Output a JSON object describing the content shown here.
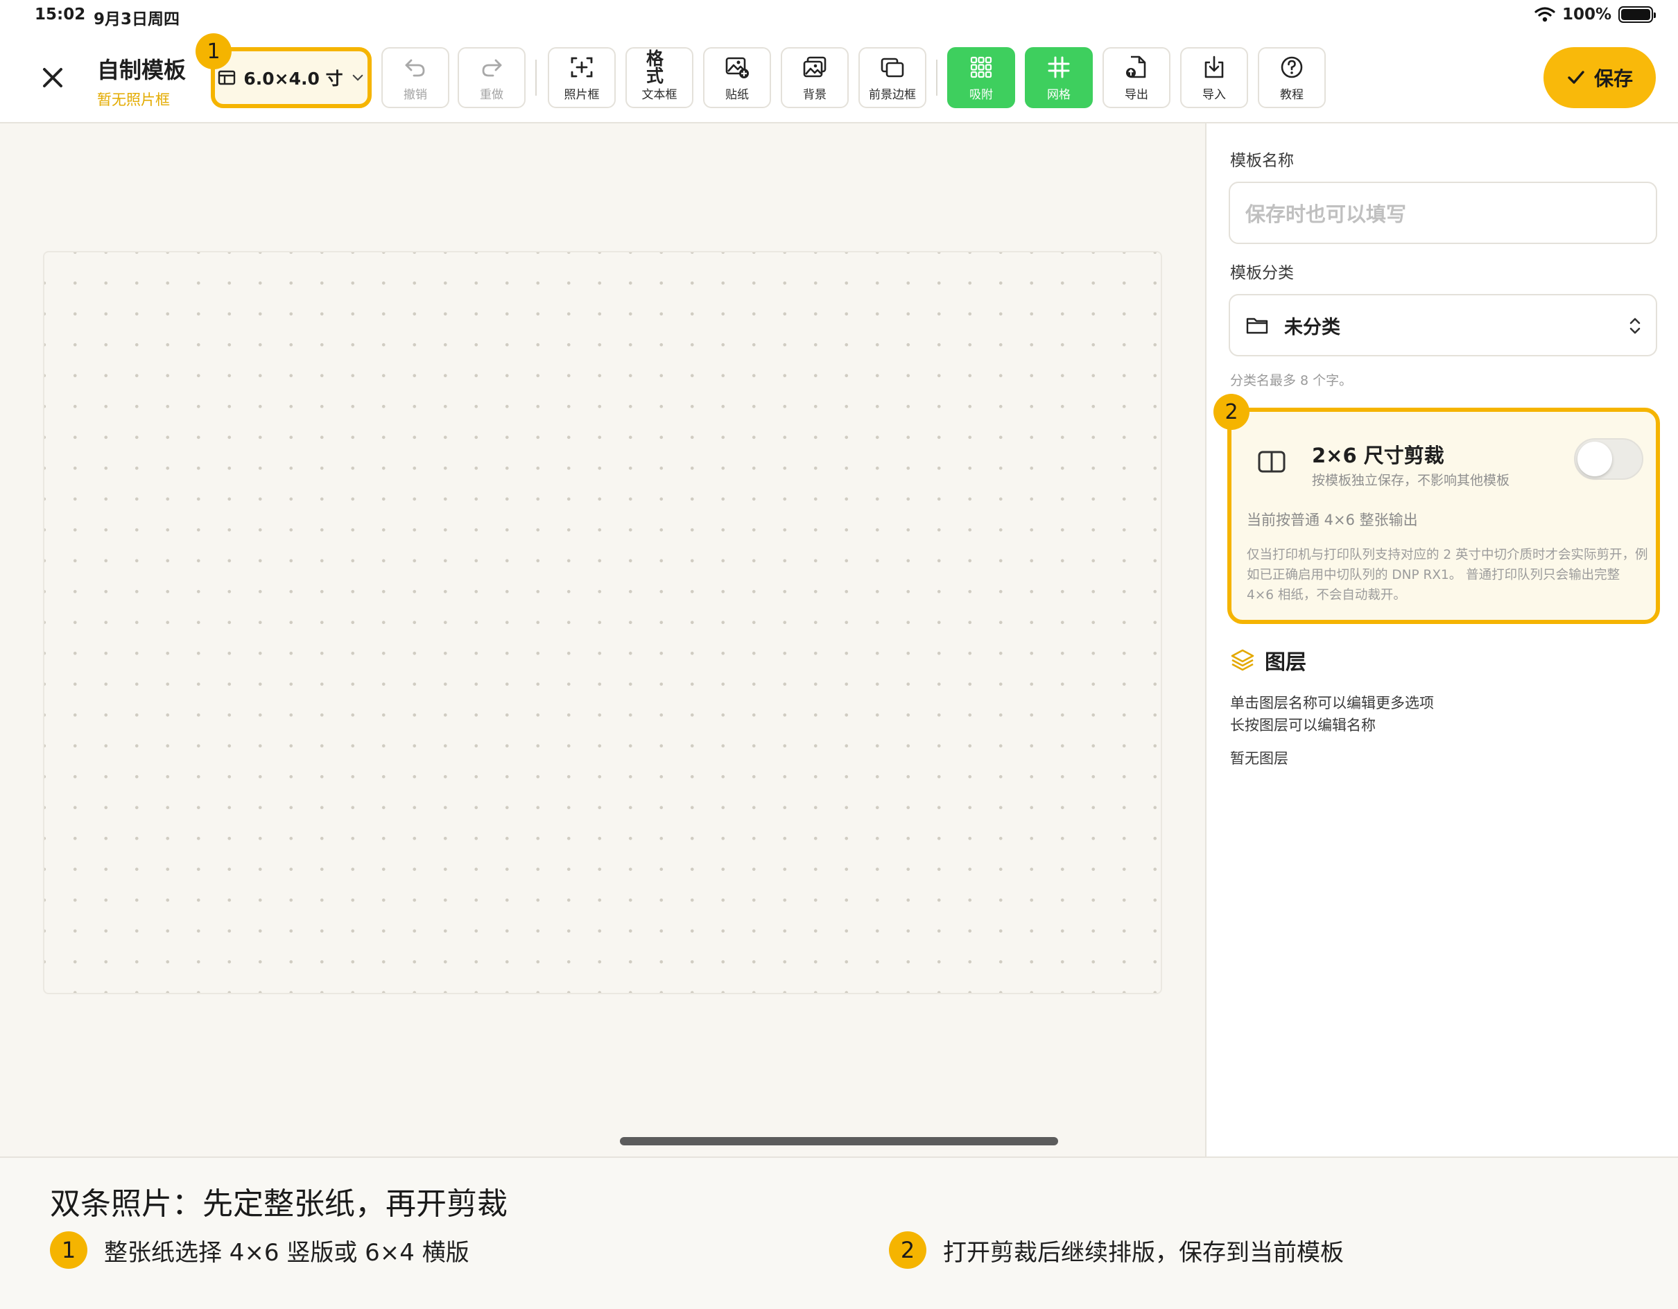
{
  "status_bar": {
    "time": "15:02",
    "date": "9月3日周四",
    "battery_percent": "100%"
  },
  "toolbar": {
    "title": "自制模板",
    "subtitle": "暂无照片框",
    "size_value": "6.0×4.0 寸",
    "undo_label": "撤销",
    "redo_label": "重做",
    "photo_frame_label": "照片框",
    "format_icon_text": "格式",
    "text_box_label": "文本框",
    "sticker_label": "贴纸",
    "background_label": "背景",
    "foreground_border_label": "前景边框",
    "snap_label": "吸附",
    "grid_label": "网格",
    "export_label": "导出",
    "import_label": "导入",
    "tutorial_label": "教程",
    "save_label": "保存"
  },
  "badges": {
    "one": "1",
    "two": "2"
  },
  "panel": {
    "name_label": "模板名称",
    "name_placeholder": "保存时也可以填写",
    "category_label": "模板分类",
    "category_value": "未分类",
    "category_hint": "分类名最多 8 个字。",
    "crop": {
      "title": "2×6 尺寸剪裁",
      "subtitle": "按模板独立保存，不影响其他模板",
      "enabled": false,
      "status": "当前按普通 4×6 整张输出",
      "description": "仅当打印机与打印队列支持对应的 2 英寸中切介质时才会实际剪开，例如已正确启用中切队列的 DNP RX1。 普通打印队列只会输出完整 4×6 相纸，不会自动裁开。"
    },
    "layers": {
      "title": "图层",
      "hint1": "单击图层名称可以编辑更多选项",
      "hint2": "长按图层可以编辑名称",
      "empty": "暂无图层"
    }
  },
  "caption": {
    "title": "双条照片：先定整张纸，再开剪裁",
    "step1": "整张纸选择 4×6 竖版或 6×4 横版",
    "step2": "打开剪裁后继续排版，保存到当前模板"
  },
  "colors": {
    "accent": "#f5b400",
    "save": "#f9b90a",
    "active_green": "#3ecf5e"
  },
  "icons": [
    "wifi-icon",
    "battery-icon",
    "close-icon",
    "frame-size-icon",
    "chevron-down-icon",
    "undo-icon",
    "redo-icon",
    "add-frame-icon",
    "sticker-icon",
    "background-image-icon",
    "foreground-border-icon",
    "snap-grid-icon",
    "grid-hash-icon",
    "export-icon",
    "import-icon",
    "help-icon",
    "checkmark-icon",
    "folder-icon",
    "updown-chevron-icon",
    "split-panel-icon",
    "layers-icon"
  ]
}
